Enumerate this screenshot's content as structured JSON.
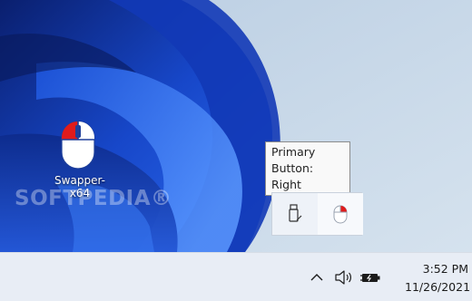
{
  "desktop": {
    "icon_label": "Swapper-x64",
    "watermark": "SOFTPEDIA®"
  },
  "tooltip": {
    "line1": "Primary Button:",
    "line2": "Right"
  },
  "tray_overflow": {
    "icons": [
      "usb-drive-icon",
      "swapper-mouse-icon"
    ]
  },
  "taskbar": {
    "icons": [
      "show-hidden-icons-chevron-icon",
      "speaker-volume-icon",
      "battery-charging-icon"
    ],
    "time": "3:52 PM",
    "date": "11/26/2021"
  },
  "colors": {
    "mouse_red": "#e01b1b",
    "mouse_blue": "#1e3f9a",
    "taskbar_bg": "#e8edf5"
  }
}
